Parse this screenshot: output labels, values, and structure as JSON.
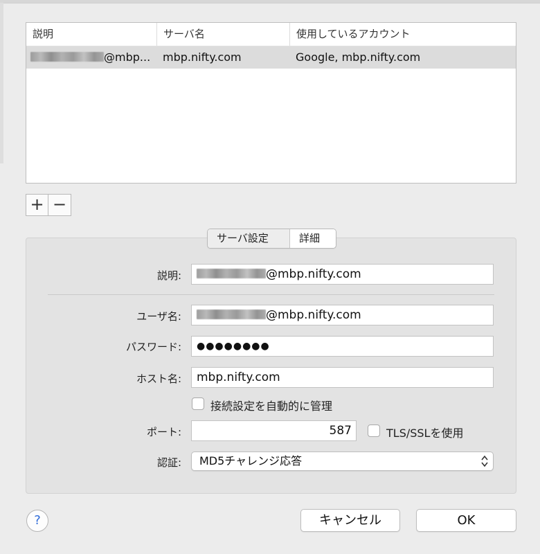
{
  "table": {
    "headers": [
      "説明",
      "サーバ名",
      "使用しているアカウント"
    ],
    "rows": [
      {
        "description_suffix": "@mbp...",
        "server": "mbp.nifty.com",
        "accounts": "Google, mbp.nifty.com"
      }
    ]
  },
  "list_buttons": {
    "add": "+",
    "remove": "−"
  },
  "tabs": [
    {
      "label": "サーバ設定",
      "selected": true
    },
    {
      "label": "詳細",
      "selected": false
    }
  ],
  "form": {
    "description_label": "説明:",
    "description_suffix": "@mbp.nifty.com",
    "username_label": "ユーザ名:",
    "username_suffix": "@mbp.nifty.com",
    "password_label": "パスワード:",
    "password_value": "●●●●●●●●",
    "host_label": "ホスト名:",
    "host_value": "mbp.nifty.com",
    "auto_manage_label": "接続設定を自動的に管理",
    "auto_manage_checked": false,
    "port_label": "ポート:",
    "port_value": "587",
    "tls_label": "TLS/SSLを使用",
    "tls_checked": false,
    "auth_label": "認証:",
    "auth_value": "MD5チャレンジ応答"
  },
  "footer": {
    "help": "?",
    "cancel": "キャンセル",
    "ok": "OK"
  },
  "colors": {
    "window_bg": "#ececec",
    "selected_row": "#dcdcdc",
    "help_accent": "#2e6bd9"
  }
}
